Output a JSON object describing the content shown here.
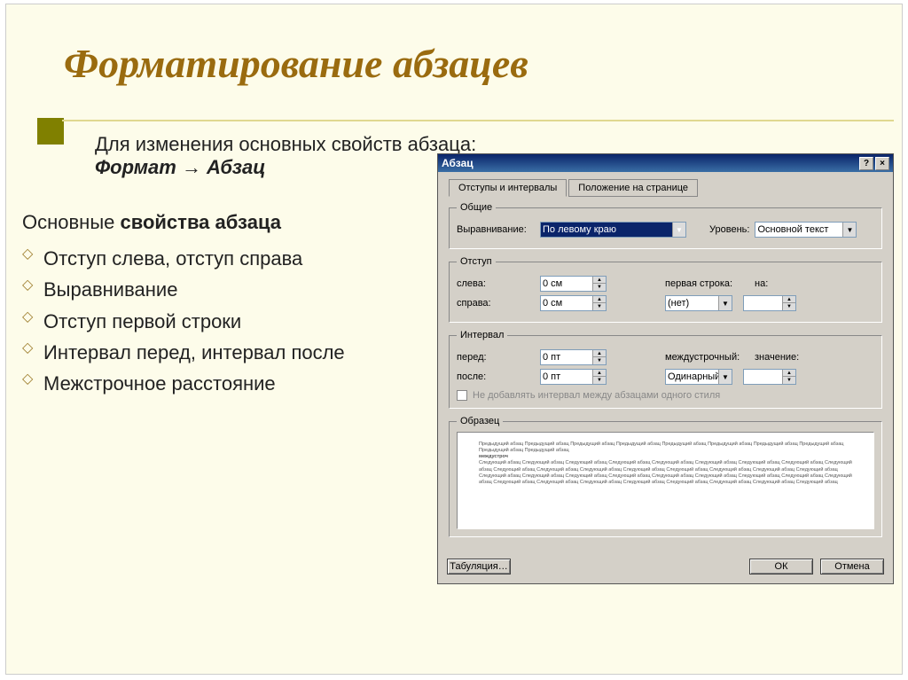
{
  "title": "Форматирование абзацев",
  "intro": {
    "line1": "Для изменения основных свойств абзаца:",
    "line2": "Формат → Абзац"
  },
  "sidebar": {
    "heading_plain": "Основные ",
    "heading_bold": "свойства абзаца",
    "items": [
      "Отступ слева, отступ справа",
      "Выравнивание",
      "Отступ первой строки",
      "Интервал перед, интервал после",
      "Межстрочное расстояние"
    ]
  },
  "dialog": {
    "title": "Абзац",
    "tabs": [
      "Отступы и интервалы",
      "Положение на странице"
    ],
    "groups": {
      "general": {
        "legend": "Общие",
        "align_label": "Выравнивание:",
        "align_value": "По левому краю",
        "level_label": "Уровень:",
        "level_value": "Основной текст"
      },
      "indent": {
        "legend": "Отступ",
        "left_label": "слева:",
        "left_value": "0 см",
        "right_label": "справа:",
        "right_value": "0 см",
        "first_label": "первая строка:",
        "first_value": "(нет)",
        "on_label": "на:",
        "on_value": ""
      },
      "interval": {
        "legend": "Интервал",
        "before_label": "перед:",
        "before_value": "0 пт",
        "after_label": "после:",
        "after_value": "0 пт",
        "line_label": "междустрочный:",
        "line_value": "Одинарный",
        "val_label": "значение:",
        "val_value": "",
        "checkbox": "Не добавлять интервал между абзацами одного стиля"
      },
      "sample": {
        "legend": "Образец"
      }
    },
    "buttons": {
      "tabs": "Табуляция…",
      "ok": "ОК",
      "cancel": "Отмена"
    }
  }
}
